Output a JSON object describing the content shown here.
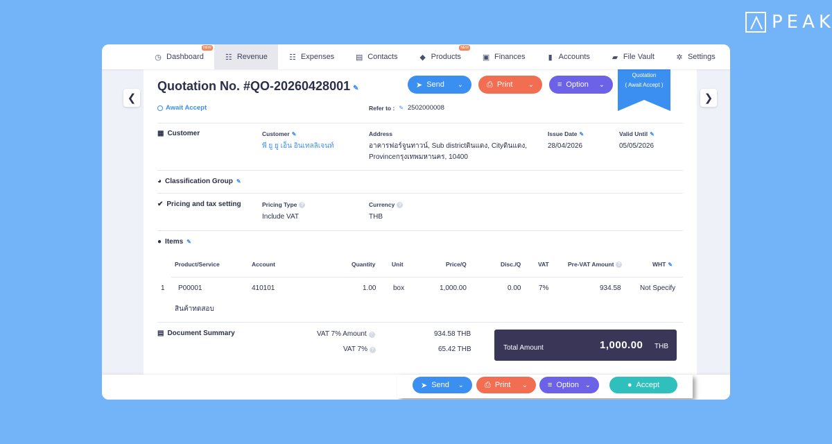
{
  "logo": {
    "text": "PEAK"
  },
  "nav": {
    "items": [
      {
        "label": "Dashboard",
        "icon": "dashboard-icon",
        "glyph": "◷",
        "badge": "NEW"
      },
      {
        "label": "Revenue",
        "icon": "revenue-icon",
        "glyph": "☷",
        "active": true
      },
      {
        "label": "Expenses",
        "icon": "expenses-icon",
        "glyph": "☷"
      },
      {
        "label": "Contacts",
        "icon": "contacts-icon",
        "glyph": "▤"
      },
      {
        "label": "Products",
        "icon": "products-icon",
        "glyph": "◆",
        "badge": "NEW"
      },
      {
        "label": "Finances",
        "icon": "finances-icon",
        "glyph": "▣"
      },
      {
        "label": "Accounts",
        "icon": "accounts-icon",
        "glyph": "▮"
      },
      {
        "label": "File Vault",
        "icon": "folder-icon",
        "glyph": "▰"
      },
      {
        "label": "Settings",
        "icon": "gear-icon",
        "glyph": "✲"
      }
    ]
  },
  "doc": {
    "title": "Quotation No. #QO-20260428001",
    "status": "Await Accept",
    "refer_label": "Refer to :",
    "refer_value": "2502000008",
    "ribbon_line1": "Quotation",
    "ribbon_line2": "( Await Accept )"
  },
  "actions": {
    "send": "Send",
    "print": "Print",
    "option": "Option",
    "accept": "Accept"
  },
  "customer": {
    "section": "Customer",
    "customer_label": "Customer",
    "customer_value": "พี ยู ยู เอ็น อินเทลลิเจนท์",
    "address_label": "Address",
    "address_line1": "อาคารฟอร์จูนทาวน์, Sub districtดินแดง, Cityดินแดง,",
    "address_line2": "Provinceกรุงเทพมหานคร, 10400",
    "issue_label": "Issue Date",
    "issue_value": "28/04/2026",
    "valid_label": "Valid Until",
    "valid_value": "05/05/2026"
  },
  "classification": {
    "section": "Classification Group"
  },
  "pricing": {
    "section": "Pricing and tax setting",
    "type_label": "Pricing Type",
    "type_value": "Include VAT",
    "currency_label": "Currency",
    "currency_value": "THB"
  },
  "items": {
    "section": "Items",
    "headers": {
      "product": "Product/Service",
      "account": "Account",
      "quantity": "Quantity",
      "unit": "Unit",
      "price": "Price/Q",
      "disc": "Disc./Q",
      "vat": "VAT",
      "prevat": "Pre-VAT Amount",
      "wht": "WHT"
    },
    "rows": [
      {
        "no": "1",
        "product": "P00001",
        "description": "สินค้าทดสอบ",
        "account": "410101",
        "quantity": "1.00",
        "unit": "box",
        "price": "1,000.00",
        "disc": "0.00",
        "vat": "7%",
        "prevat": "934.58",
        "wht": "Not Specify"
      }
    ]
  },
  "summary": {
    "section": "Document Summary",
    "vat_amount_label": "VAT 7% Amount",
    "vat_amount_value": "934.58 THB",
    "vat_label": "VAT 7%",
    "vat_value": "65.42 THB",
    "total_label": "Total Amount",
    "total_value": "1,000.00",
    "total_currency": "THB"
  },
  "colors": {
    "background": "#73b4f9",
    "send": "#3b8ff0",
    "print": "#f16e53",
    "option": "#6b62e8",
    "accept": "#2fbfbd",
    "total_box": "#393658"
  }
}
